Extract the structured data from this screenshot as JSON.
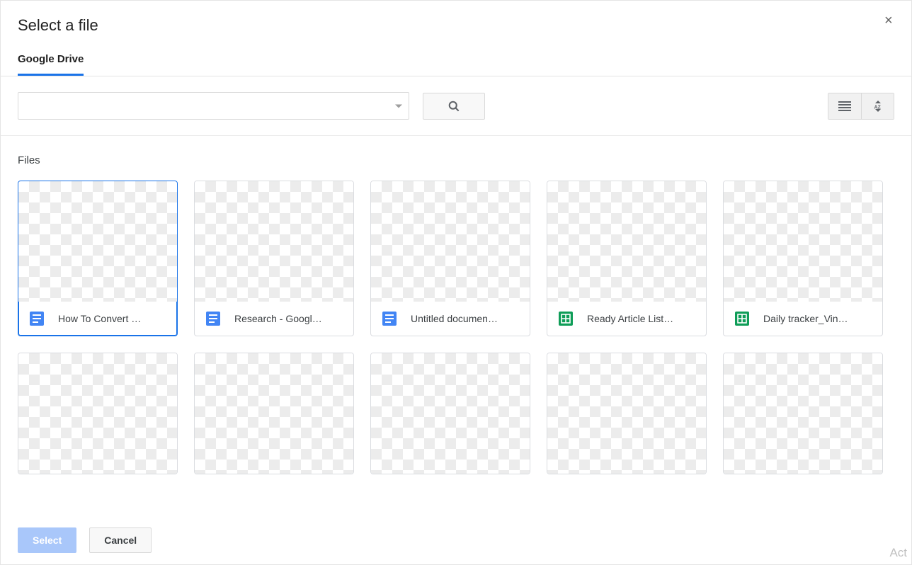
{
  "header": {
    "title": "Select a file"
  },
  "tabs": [
    {
      "label": "Google Drive"
    }
  ],
  "toolbar": {
    "search_value": "",
    "search_placeholder": ""
  },
  "section": {
    "label": "Files"
  },
  "files": [
    {
      "name": "How To Convert …",
      "type": "docs",
      "selected": true
    },
    {
      "name": "Research - Googl…",
      "type": "docs",
      "selected": false
    },
    {
      "name": "Untitled documen…",
      "type": "docs",
      "selected": false
    },
    {
      "name": "Ready Article List…",
      "type": "sheets",
      "selected": false
    },
    {
      "name": "Daily tracker_Vin…",
      "type": "sheets",
      "selected": false
    },
    {
      "name": "",
      "type": "",
      "selected": false
    },
    {
      "name": "",
      "type": "",
      "selected": false
    },
    {
      "name": "",
      "type": "",
      "selected": false
    },
    {
      "name": "",
      "type": "",
      "selected": false
    },
    {
      "name": "",
      "type": "",
      "selected": false
    }
  ],
  "footer": {
    "select_label": "Select",
    "cancel_label": "Cancel"
  },
  "watermark": "Act"
}
